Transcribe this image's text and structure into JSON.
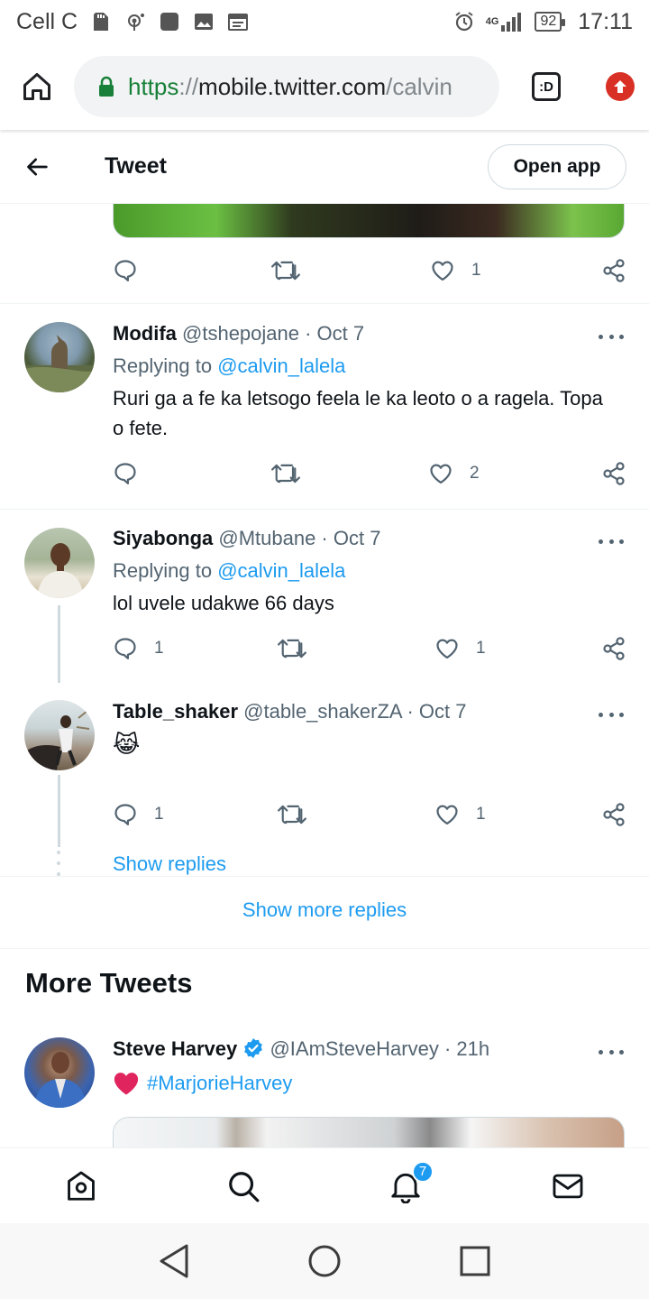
{
  "status_bar": {
    "carrier": "Cell C",
    "network": "4G",
    "battery": "92",
    "time": "17:11"
  },
  "browser": {
    "url_scheme": "https",
    "url_sep": "://",
    "url_host": "mobile.twitter.com",
    "url_path": "/calvin",
    "tab_label": ":D"
  },
  "header": {
    "title": "Tweet",
    "open_app": "Open app"
  },
  "top_actions": {
    "likes": "1"
  },
  "tweets": [
    {
      "name": "Modifa",
      "handle": "@tshepojane · Oct 7",
      "replying_prefix": "Replying to ",
      "replying_to": "@calvin_lalela",
      "text": "Ruri ga a fe ka letsogo feela le ka leoto o a ragela. Topa o fete.",
      "replies": "",
      "likes": "2"
    },
    {
      "name": "Siyabonga",
      "handle": "@Mtubane · Oct 7",
      "replying_prefix": "Replying to ",
      "replying_to": "@calvin_lalela",
      "text": "lol uvele udakwe 66 days",
      "replies": "1",
      "likes": "1"
    },
    {
      "name": "Table_shaker",
      "handle": "@table_shakerZA · Oct 7",
      "text": "😹",
      "replies": "1",
      "likes": "1"
    }
  ],
  "show_replies": "Show replies",
  "show_more_replies": "Show more replies",
  "more_tweets": {
    "title": "More Tweets",
    "tweet": {
      "name": "Steve Harvey",
      "handle": "@IAmSteveHarvey · 21h",
      "hashtag": "#MarjorieHarvey"
    }
  },
  "bottom_nav": {
    "notification_count": "7"
  },
  "colors": {
    "accent": "#1d9bf0",
    "text": "#0f1419",
    "secondary": "#536471",
    "url_green": "#188038"
  }
}
